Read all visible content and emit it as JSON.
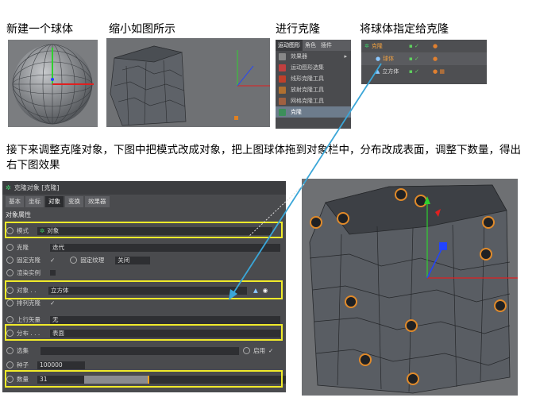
{
  "captions": {
    "step1": "新建一个球体",
    "step2": "缩小如图所示",
    "step3": "进行克隆",
    "step4": "将球体指定给克隆",
    "description": "接下来调整克隆对象，下图中把模式改成对象，把上图球体拖到对象栏中，分布改成表面，调整下数量，得出右下图效果"
  },
  "menu": {
    "tabs": [
      "运动图形",
      "角色",
      "插件"
    ],
    "items": [
      "效果器",
      "运动图形选集",
      "线形克隆工具",
      "放射克隆工具",
      "网格克隆工具",
      "克隆"
    ],
    "selected": "克隆"
  },
  "object_manager": {
    "rows": [
      {
        "name": "克隆",
        "icon": "cloner-icon"
      },
      {
        "name": "球体",
        "icon": "sphere-icon"
      },
      {
        "name": "立方体",
        "icon": "cube-icon"
      }
    ]
  },
  "attributes": {
    "title": "克隆对象 [克隆]",
    "tabs": [
      "基本",
      "坐标",
      "对象",
      "变换",
      "效果器"
    ],
    "active_tab": "对象",
    "section": "对象属性",
    "mode_label": "模式",
    "mode_value": "对象",
    "clones_label": "克隆",
    "clones_value": "迭代",
    "fix_clone_label": "固定克隆",
    "fix_texture_label": "固定纹理",
    "fix_texture_value": "关闭",
    "render_instances_label": "渲染实例",
    "object_label": "对象 . .",
    "object_value": "立方体",
    "arrange_label": "排列克隆",
    "up_vector_label": "上行矢量",
    "up_vector_value": "无",
    "distribution_label": "分布 . . .",
    "distribution_value": "表面",
    "selection_label": "选集",
    "enable_label": "启用",
    "seed_label": "种子",
    "seed_value": "100000",
    "count_label": "数量",
    "count_value": "31"
  },
  "colors": {
    "highlight_box": "#f0ea2a",
    "drag_arrow": "#3aa6d8"
  }
}
